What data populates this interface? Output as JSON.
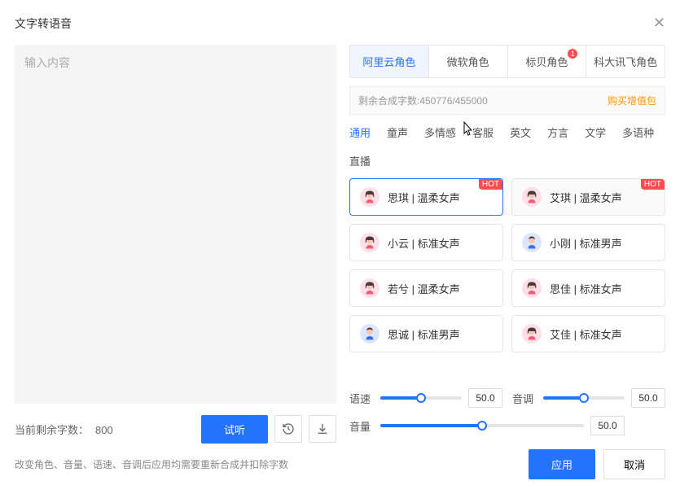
{
  "title": "文字转语音",
  "textarea": {
    "placeholder": "输入内容"
  },
  "charCount": {
    "label": "当前剩余字数：",
    "value": "800"
  },
  "leftActions": {
    "preview": "试听"
  },
  "tabs": {
    "items": [
      {
        "label": "阿里云角色",
        "active": true
      },
      {
        "label": "微软角色"
      },
      {
        "label": "标贝角色",
        "badge": "1"
      },
      {
        "label": "科大讯飞角色"
      }
    ]
  },
  "quota": {
    "text": "剩余合成字数:450776/455000",
    "buy": "购买增值包"
  },
  "categories": [
    {
      "label": "通用",
      "active": true
    },
    {
      "label": "童声"
    },
    {
      "label": "多情感"
    },
    {
      "label": "客服"
    },
    {
      "label": "英文"
    },
    {
      "label": "方言"
    },
    {
      "label": "文学"
    },
    {
      "label": "多语种"
    },
    {
      "label": "直播"
    }
  ],
  "voices": [
    {
      "label": "思琪 | 温柔女声",
      "gender": "female",
      "hot": true,
      "active": true
    },
    {
      "label": "艾琪 | 温柔女声",
      "gender": "female",
      "hot": true,
      "alt": true
    },
    {
      "label": "小云 | 标准女声",
      "gender": "female"
    },
    {
      "label": "小刚 | 标准男声",
      "gender": "male"
    },
    {
      "label": "若兮 | 温柔女声",
      "gender": "female"
    },
    {
      "label": "思佳 | 标准女声",
      "gender": "female"
    },
    {
      "label": "思诚 | 标准男声",
      "gender": "male"
    },
    {
      "label": "艾佳 | 标准女声",
      "gender": "female"
    }
  ],
  "hotLabel": "HOT",
  "sliders": {
    "speed": {
      "label": "语速",
      "value": "50.0",
      "pct": 50
    },
    "pitch": {
      "label": "音调",
      "value": "50.0",
      "pct": 50
    },
    "volume": {
      "label": "音量",
      "value": "50.0",
      "pct": 50
    }
  },
  "footer": {
    "note": "改变角色、音量、语速、音调后应用均需要重新合成并扣除字数",
    "apply": "应用",
    "cancel": "取消"
  }
}
